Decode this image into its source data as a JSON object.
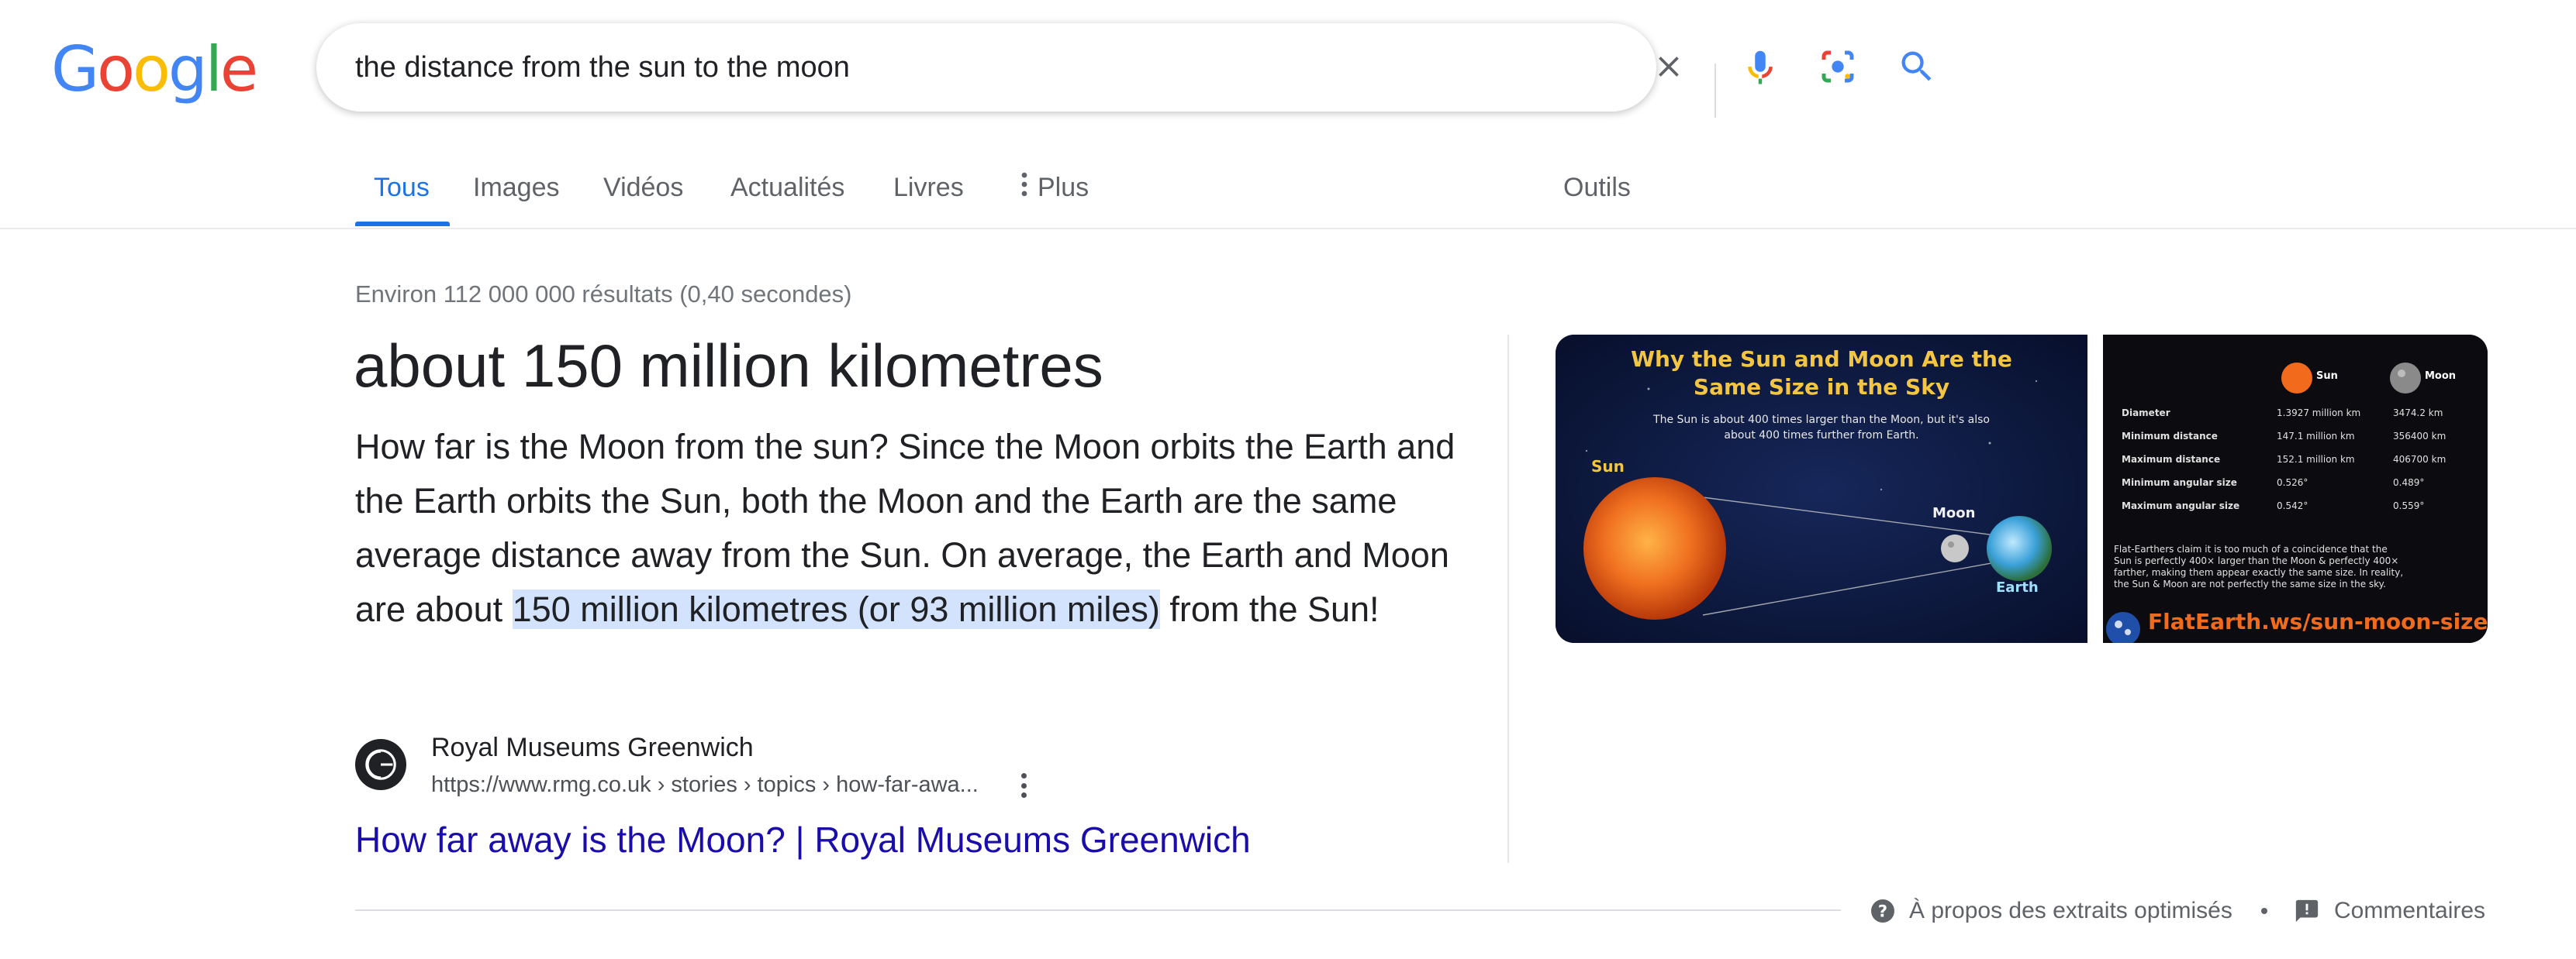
{
  "logo": {
    "text": "Google",
    "letters": [
      "G",
      "o",
      "o",
      "g",
      "l",
      "e"
    ],
    "colors": [
      "#4285F4",
      "#EA4335",
      "#FBBC05",
      "#4285F4",
      "#34A853",
      "#EA4335"
    ]
  },
  "search": {
    "query": "the distance from the sun to the moon"
  },
  "icons": {
    "clear": "close-icon",
    "voice": "microphone-icon",
    "lens": "google-lens-icon",
    "search": "search-icon",
    "more": "more-vert-icon",
    "help": "help-circle-icon",
    "feedback": "feedback-icon"
  },
  "tabs": [
    {
      "label": "Tous",
      "active": true
    },
    {
      "label": "Images"
    },
    {
      "label": "Vidéos"
    },
    {
      "label": "Actualités"
    },
    {
      "label": "Livres"
    },
    {
      "label": "Plus"
    }
  ],
  "tools_label": "Outils",
  "stats": "Environ 112 000 000 résultats (0,40 secondes)",
  "snippet": {
    "answer": "about 150 million kilometres",
    "text_before": "How far is the Moon from the sun? Since the Moon orbits the Earth and the Earth orbits the Sun, both the Moon and the Earth are the same average distance away from the Sun. On average, the Earth and Moon are about ",
    "text_highlight": "150 million kilometres (or 93 million miles)",
    "text_after": " from the Sun!",
    "source_name": "Royal Museums Greenwich",
    "source_url": "https://www.rmg.co.uk › stories › topics › how-far-awa...",
    "link_title": "How far away is the Moon? | Royal Museums Greenwich"
  },
  "images": {
    "first": {
      "title_line1": "Why the Sun and Moon Are the",
      "title_line2": "Same Size in the Sky",
      "caption_line1": "The Sun is about 400 times larger than the Moon, but it's also",
      "caption_line2": "about 400 times further from Earth.",
      "label_sun": "Sun",
      "label_moon": "Moon",
      "label_earth": "Earth"
    },
    "second": {
      "col_sun": "Sun",
      "col_moon": "Moon",
      "rows": [
        {
          "label": "Diameter",
          "sun": "1.3927 million km",
          "moon": "3474.2 km"
        },
        {
          "label": "Minimum distance",
          "sun": "147.1 million km",
          "moon": "356400 km"
        },
        {
          "label": "Maximum distance",
          "sun": "152.1 million km",
          "moon": "406700 km"
        },
        {
          "label": "Minimum angular size",
          "sun": "0.526°",
          "moon": "0.489°"
        },
        {
          "label": "Maximum angular size",
          "sun": "0.542°",
          "moon": "0.559°"
        }
      ],
      "note_line1": "Flat-Earthers claim it is too much of a coincidence that the",
      "note_line2": "Sun is perfectly 400× larger than the Moon & perfectly 400×",
      "note_line3": "farther, making them appear exactly the same size. In reality,",
      "note_line4": "the Sun & Moon are not perfectly the same size in the sky.",
      "site": "FlatEarth.ws/sun-moon-size"
    }
  },
  "footer": {
    "about": "À propos des extraits optimisés",
    "feedback": "Commentaires"
  }
}
